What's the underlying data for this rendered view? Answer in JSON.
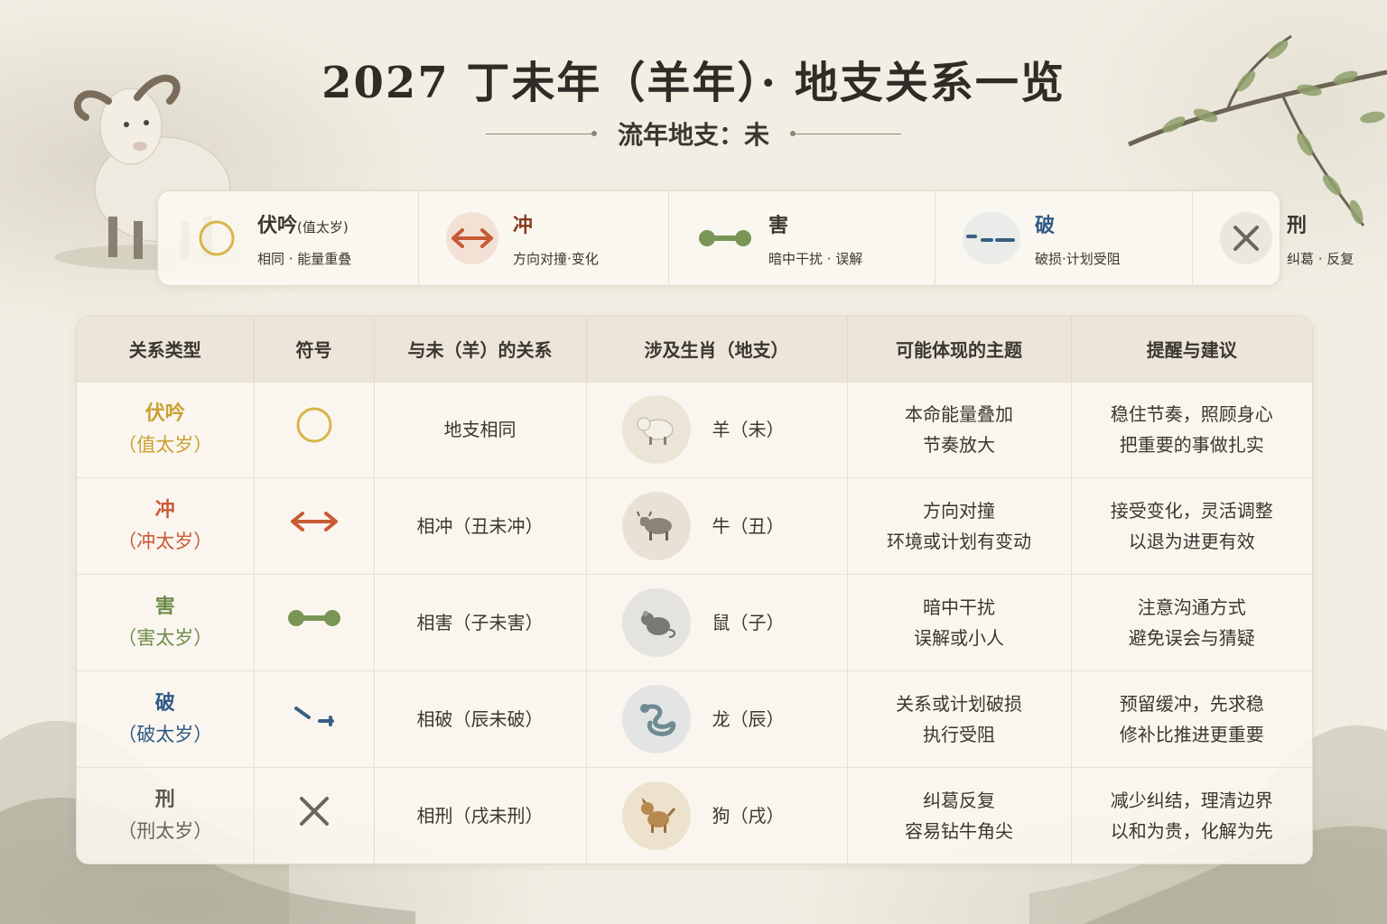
{
  "header": {
    "title": "2027 丁未年（羊年）· 地支关系一览",
    "subtitle": "流年地支：未"
  },
  "legend": [
    {
      "name": "伏吟",
      "name_note": "(值太岁)",
      "desc": "相同 · 能量重叠",
      "icon": "circle-icon",
      "color": "#d9b44a"
    },
    {
      "name": "冲",
      "name_note": "",
      "desc": "方向对撞·变化",
      "icon": "double-arrow-icon",
      "color": "#c85a36"
    },
    {
      "name": "害",
      "name_note": "",
      "desc": "暗中干扰 · 误解",
      "icon": "dumbbell-icon",
      "color": "#7a9656"
    },
    {
      "name": "破",
      "name_note": "",
      "desc": "破损·计划受阻",
      "icon": "broken-line-icon",
      "color": "#3a5f86"
    },
    {
      "name": "刑",
      "name_note": "",
      "desc": "纠葛 · 反复",
      "icon": "cross-icon",
      "color": "#6b655c"
    }
  ],
  "table": {
    "headers": [
      "关系类型",
      "符号",
      "与未（羊）的关系",
      "涉及生肖（地支）",
      "可能体现的主题",
      "提醒与建议"
    ],
    "rows": [
      {
        "type": "伏吟",
        "type_sub": "（值太岁）",
        "color": "#c9a030",
        "symbol": "circle-icon",
        "relation": "地支相同",
        "zodiac": "羊（未）",
        "zodiac_icon": "sheep-icon",
        "theme": [
          "本命能量叠加",
          "节奏放大"
        ],
        "advice": [
          "稳住节奏，照顾身心",
          "把重要的事做扎实"
        ]
      },
      {
        "type": "冲",
        "type_sub": "（冲太岁）",
        "color": "#c85a36",
        "symbol": "double-arrow-icon",
        "relation": "相冲（丑未冲）",
        "zodiac": "牛（丑）",
        "zodiac_icon": "ox-icon",
        "theme": [
          "方向对撞",
          "环境或计划有变动"
        ],
        "advice": [
          "接受变化，灵活调整",
          "以退为进更有效"
        ]
      },
      {
        "type": "害",
        "type_sub": "（害太岁）",
        "color": "#6e8c4c",
        "symbol": "dumbbell-icon",
        "relation": "相害（子未害）",
        "zodiac": "鼠（子）",
        "zodiac_icon": "rat-icon",
        "theme": [
          "暗中干扰",
          "误解或小人"
        ],
        "advice": [
          "注意沟通方式",
          "避免误会与猜疑"
        ]
      },
      {
        "type": "破",
        "type_sub": "（破太岁）",
        "color": "#2f5a85",
        "symbol": "broken-line-icon",
        "relation": "相破（辰未破）",
        "zodiac": "龙（辰）",
        "zodiac_icon": "dragon-icon",
        "theme": [
          "关系或计划破损",
          "执行受阻"
        ],
        "advice": [
          "预留缓冲，先求稳",
          "修补比推进更重要"
        ]
      },
      {
        "type": "刑",
        "type_sub": "（刑太岁）",
        "color": "#5e5850",
        "symbol": "cross-icon",
        "relation": "相刑（戌未刑）",
        "zodiac": "狗（戌）",
        "zodiac_icon": "dog-icon",
        "theme": [
          "纠葛反复",
          "容易钻牛角尖"
        ],
        "advice": [
          "减少纠结，理清边界",
          "以和为贵，化解为先"
        ]
      }
    ]
  }
}
